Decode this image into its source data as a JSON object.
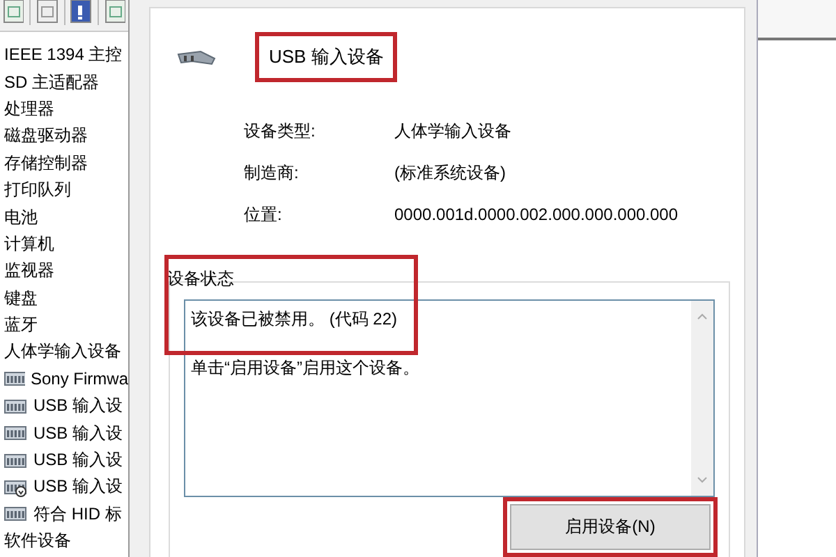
{
  "device_tree": [
    {
      "label": "IEEE 1394 主控"
    },
    {
      "label": "SD 主适配器"
    },
    {
      "label": "处理器"
    },
    {
      "label": "磁盘驱动器"
    },
    {
      "label": "存储控制器"
    },
    {
      "label": "打印队列"
    },
    {
      "label": "电池"
    },
    {
      "label": "计算机"
    },
    {
      "label": "监视器"
    },
    {
      "label": "键盘"
    },
    {
      "label": "蓝牙"
    },
    {
      "label": "人体学输入设备",
      "children": [
        {
          "label": "Sony Firmwa",
          "disabled": false
        },
        {
          "label": "USB 输入设",
          "disabled": false
        },
        {
          "label": "USB 输入设",
          "disabled": false
        },
        {
          "label": "USB 输入设",
          "disabled": false
        },
        {
          "label": "USB 输入设",
          "disabled": true
        },
        {
          "label": "符合 HID 标",
          "disabled": false
        }
      ]
    },
    {
      "label": "软件设备"
    }
  ],
  "device": {
    "name": "USB 输入设备",
    "highlighted": true
  },
  "properties": [
    {
      "label": "设备类型:",
      "value": "人体学输入设备"
    },
    {
      "label": "制造商:",
      "value": "(标准系统设备)"
    },
    {
      "label": "位置:",
      "value": "0000.001d.0000.002.000.000.000.000"
    }
  ],
  "device_status": {
    "title": "设备状态",
    "lines": [
      "该设备已被禁用。 (代码 22)",
      "单击“启用设备”启用这个设备。"
    ],
    "highlighted": true
  },
  "enable_button": {
    "label": "启用设备(N)",
    "highlighted": true
  }
}
